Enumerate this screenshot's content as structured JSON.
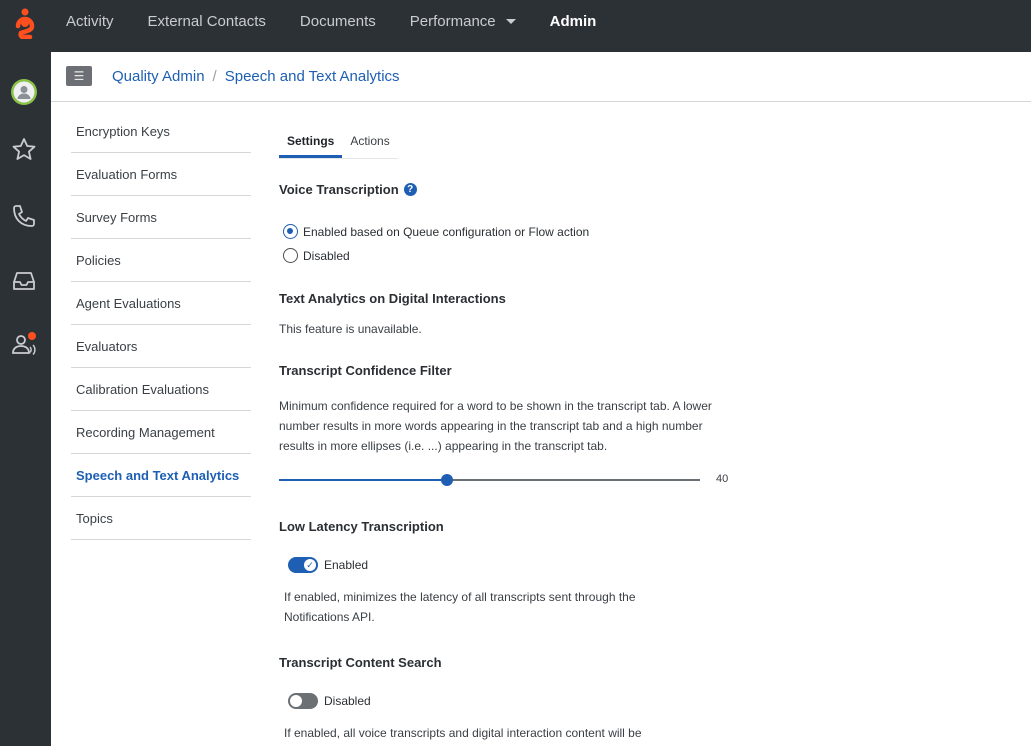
{
  "topnav": {
    "items": [
      {
        "label": "Activity"
      },
      {
        "label": "External Contacts"
      },
      {
        "label": "Documents"
      },
      {
        "label": "Performance"
      },
      {
        "label": "Admin"
      }
    ]
  },
  "header": {
    "menu_icon": "hamburger-icon",
    "breadcrumb": [
      "Quality Admin",
      "/",
      "Speech and Text Analytics"
    ]
  },
  "sidenav": {
    "items": [
      {
        "label": "Encryption Keys"
      },
      {
        "label": "Evaluation Forms"
      },
      {
        "label": "Survey Forms"
      },
      {
        "label": "Policies"
      },
      {
        "label": "Agent Evaluations"
      },
      {
        "label": "Evaluators"
      },
      {
        "label": "Calibration Evaluations"
      },
      {
        "label": "Recording Management"
      },
      {
        "label": "Speech and Text Analytics"
      },
      {
        "label": "Topics"
      }
    ],
    "active": "Speech and Text Analytics"
  },
  "tabs": [
    {
      "label": "Settings"
    },
    {
      "label": "Actions"
    }
  ],
  "voice_transcription": {
    "title": "Voice Transcription",
    "help": "?",
    "options": [
      {
        "label": "Enabled based on Queue configuration or Flow action",
        "checked": true
      },
      {
        "label": "Disabled",
        "checked": false
      }
    ]
  },
  "text_analytics": {
    "title": "Text Analytics on Digital Interactions",
    "status": "This feature is unavailable."
  },
  "confidence_filter": {
    "title": "Transcript Confidence Filter",
    "description": "Minimum confidence required for a word to be shown in the transcript tab. A lower number results in more words appearing in the transcript tab and a high number results in more ellipses (i.e. ...) appearing in the transcript tab.",
    "value": "40",
    "min": 0,
    "max": 100
  },
  "low_latency": {
    "title": "Low Latency Transcription",
    "toggle_label": "Enabled",
    "enabled": true,
    "description": "If enabled, minimizes the latency of all transcripts sent through the Notifications API."
  },
  "content_search": {
    "title": "Transcript Content Search",
    "toggle_label": "Disabled",
    "enabled": false,
    "description": "If enabled, all voice transcripts and digital interaction content will be"
  },
  "colors": {
    "brand": "#ff4f1f",
    "accent": "#1e5fb4",
    "topbar": "#2c3136"
  }
}
